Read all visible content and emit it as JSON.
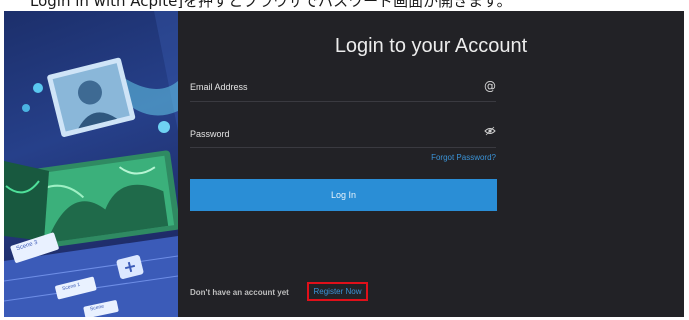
{
  "caption": "Login in with Acpite]を押すとブラウザでパスワード画面が開きます。",
  "login": {
    "title": "Login to your Account",
    "email_label": "Email Address",
    "password_label": "Password",
    "forgot_password": "Forgot Password?",
    "login_button": "Log In",
    "no_account": "Don't have an account yet",
    "register": "Register Now"
  },
  "artwork": {
    "cards": [
      "Scene 3",
      "Scene 1",
      "Scene"
    ]
  },
  "icons": {
    "email": "at-icon",
    "password": "eye-icon"
  },
  "colors": {
    "accent": "#2a8ed6",
    "highlight": "#e0101a",
    "background": "#222226"
  }
}
